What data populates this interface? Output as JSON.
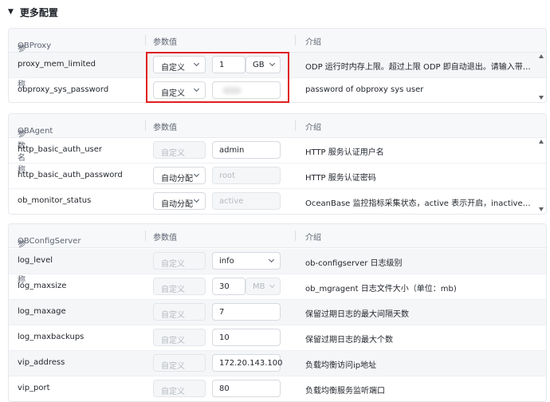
{
  "section": {
    "title": "更多配置"
  },
  "columns": {
    "name_suffix": "参数名称",
    "value": "参数值",
    "desc": "介绍"
  },
  "cards": [
    {
      "prefix": "OBProxy",
      "rows": [
        {
          "name": "proxy_mem_limited",
          "select": "自定义",
          "select_disabled": false,
          "value": "1",
          "unit": "GB",
          "unit_disabled": false,
          "desc": "ODP 运行时内存上限。超过上限 ODP 即自动退出。请输入带容..."
        },
        {
          "name": "obproxy_sys_password",
          "select": "自定义",
          "select_disabled": false,
          "value": "",
          "blurred": true,
          "desc": "password of obproxy sys user"
        }
      ]
    },
    {
      "prefix": "OBAgent",
      "rows": [
        {
          "name": "http_basic_auth_user",
          "select": "自定义",
          "select_disabled": true,
          "value": "admin",
          "value_disabled": false,
          "desc": "HTTP 服务认证用户名"
        },
        {
          "name": "http_basic_auth_password",
          "select": "自动分配",
          "select_disabled": false,
          "value": "root",
          "value_disabled": true,
          "desc": "HTTP 服务认证密码"
        },
        {
          "name": "ob_monitor_status",
          "select": "自动分配",
          "select_disabled": false,
          "value": "active",
          "value_disabled": true,
          "desc": "OceanBase 监控指标采集状态，active 表示开启，inactive 表示关..."
        }
      ]
    },
    {
      "prefix": "OBConfigServer",
      "rows": [
        {
          "name": "log_level",
          "select": "自定义",
          "select_disabled": true,
          "value": "info",
          "value_is_select": true,
          "desc": "ob-configserver 日志级别"
        },
        {
          "name": "log_maxsize",
          "select": "自定义",
          "select_disabled": true,
          "value": "30",
          "unit": "MB",
          "unit_disabled": true,
          "desc": "ob_mgragent 日志文件大小（单位：mb)"
        },
        {
          "name": "log_maxage",
          "select": "自定义",
          "select_disabled": true,
          "value": "7",
          "desc": "保留过期日志的最大间隔天数"
        },
        {
          "name": "log_maxbackups",
          "select": "自定义",
          "select_disabled": true,
          "value": "10",
          "desc": "保留过期日志的最大个数"
        },
        {
          "name": "vip_address",
          "select": "自定义",
          "select_disabled": true,
          "value": "172.20.143.100",
          "desc": "负载均衡访问ip地址"
        },
        {
          "name": "vip_port",
          "select": "自定义",
          "select_disabled": true,
          "value": "80",
          "desc": "负载均衡服务监听端口"
        }
      ]
    }
  ],
  "colors": {
    "highlight": "#e02020",
    "header_bg": "#f7f8fa",
    "row_alt": "#f5f6f8"
  },
  "icons": {
    "collapse": "caret-down-icon",
    "dropdown": "chevron-down-icon"
  }
}
